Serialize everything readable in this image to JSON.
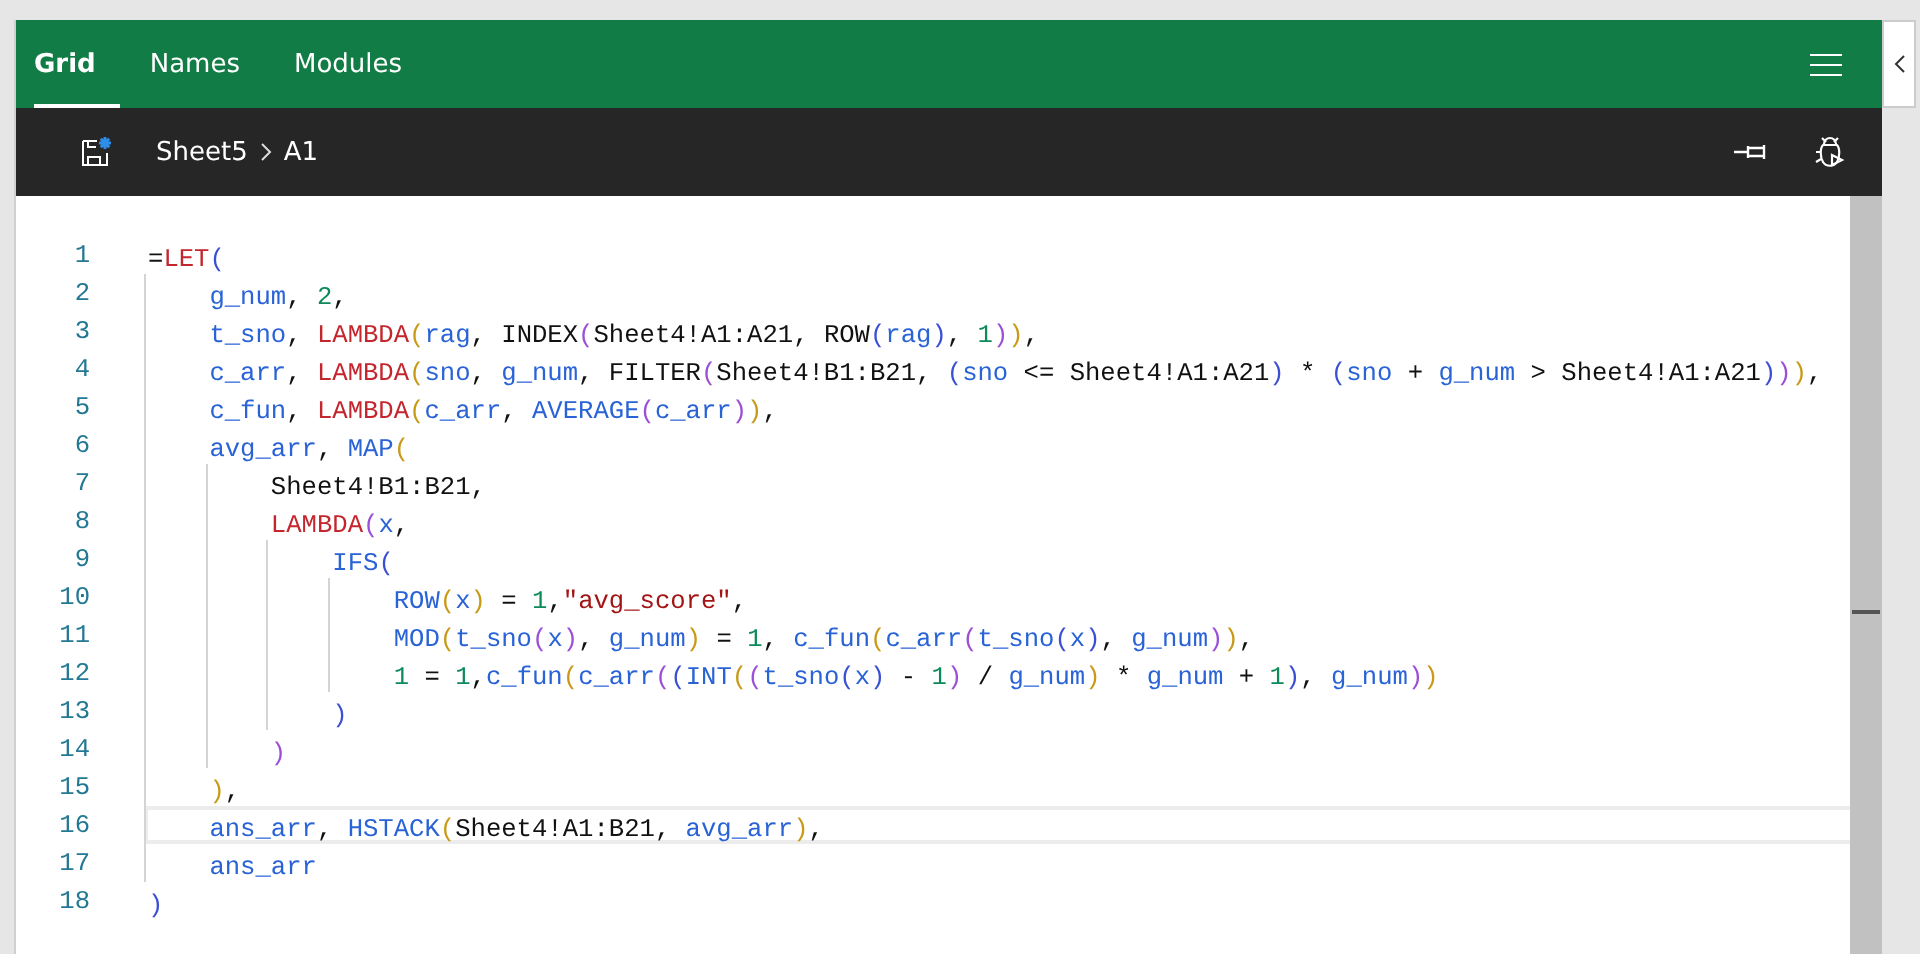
{
  "tabs": [
    {
      "label": "Grid",
      "selected": true
    },
    {
      "label": "Names",
      "selected": false
    },
    {
      "label": "Modules",
      "selected": false
    }
  ],
  "breadcrumb": [
    "Sheet5",
    "A1"
  ],
  "editor": {
    "lines": [
      {
        "number": "1",
        "current": false,
        "tokens": [
          {
            "kind": "op",
            "text": "="
          },
          {
            "kind": "kw",
            "text": "LET"
          },
          {
            "kind": "op",
            "text": "("
          }
        ]
      },
      {
        "number": "2",
        "current": false,
        "tokens": [
          {
            "kind": "id",
            "text": "g_num"
          },
          {
            "kind": "op",
            "text": ", "
          },
          {
            "kind": "num",
            "text": "2"
          },
          {
            "kind": "op",
            "text": ","
          }
        ]
      },
      {
        "number": "3",
        "current": false,
        "tokens": [
          {
            "kind": "id",
            "text": "t_sno"
          },
          {
            "kind": "op",
            "text": ", "
          },
          {
            "kind": "kw",
            "text": "LAMBDA"
          },
          {
            "kind": "op",
            "text": "("
          },
          {
            "kind": "id",
            "text": "rag"
          },
          {
            "kind": "op",
            "text": ", "
          },
          {
            "kind": "ref",
            "text": "INDEX"
          },
          {
            "kind": "op",
            "text": "("
          },
          {
            "kind": "ref",
            "text": "Sheet4!A1:A21"
          },
          {
            "kind": "op",
            "text": ", "
          },
          {
            "kind": "ref",
            "text": "ROW"
          },
          {
            "kind": "op",
            "text": "("
          },
          {
            "kind": "id",
            "text": "rag"
          },
          {
            "kind": "op",
            "text": "), "
          },
          {
            "kind": "num",
            "text": "1"
          },
          {
            "kind": "op",
            "text": ")),"
          }
        ]
      },
      {
        "number": "4",
        "current": false,
        "tokens": [
          {
            "kind": "id",
            "text": "c_arr"
          },
          {
            "kind": "op",
            "text": ", "
          },
          {
            "kind": "kw",
            "text": "LAMBDA"
          },
          {
            "kind": "op",
            "text": "("
          },
          {
            "kind": "id",
            "text": "sno"
          },
          {
            "kind": "op",
            "text": ", "
          },
          {
            "kind": "id",
            "text": "g_num"
          },
          {
            "kind": "op",
            "text": ", "
          },
          {
            "kind": "ref",
            "text": "FILTER"
          },
          {
            "kind": "op",
            "text": "("
          },
          {
            "kind": "ref",
            "text": "Sheet4!B1:B21"
          },
          {
            "kind": "op",
            "text": ", ("
          },
          {
            "kind": "id",
            "text": "sno"
          },
          {
            "kind": "op",
            "text": " <= "
          },
          {
            "kind": "ref",
            "text": "Sheet4!A1:A21"
          },
          {
            "kind": "op",
            "text": ") * ("
          },
          {
            "kind": "id",
            "text": "sno"
          },
          {
            "kind": "op",
            "text": " + "
          },
          {
            "kind": "id",
            "text": "g_num"
          },
          {
            "kind": "op",
            "text": " > "
          },
          {
            "kind": "ref",
            "text": "Sheet4!A1:A21"
          },
          {
            "kind": "op",
            "text": "))),"
          }
        ]
      },
      {
        "number": "5",
        "current": false,
        "tokens": [
          {
            "kind": "id",
            "text": "c_fun"
          },
          {
            "kind": "op",
            "text": ", "
          },
          {
            "kind": "kw",
            "text": "LAMBDA"
          },
          {
            "kind": "op",
            "text": "("
          },
          {
            "kind": "id",
            "text": "c_arr"
          },
          {
            "kind": "op",
            "text": ", "
          },
          {
            "kind": "fn",
            "text": "AVERAGE"
          },
          {
            "kind": "op",
            "text": "("
          },
          {
            "kind": "id",
            "text": "c_arr"
          },
          {
            "kind": "op",
            "text": ")),"
          }
        ]
      },
      {
        "number": "6",
        "current": false,
        "tokens": [
          {
            "kind": "id",
            "text": "avg_arr"
          },
          {
            "kind": "op",
            "text": ", "
          },
          {
            "kind": "fn",
            "text": "MAP"
          },
          {
            "kind": "op",
            "text": "("
          }
        ]
      },
      {
        "number": "7",
        "current": false,
        "tokens": [
          {
            "kind": "ref",
            "text": "Sheet4!B1:B21"
          },
          {
            "kind": "op",
            "text": ","
          }
        ]
      },
      {
        "number": "8",
        "current": false,
        "tokens": [
          {
            "kind": "kw",
            "text": "LAMBDA"
          },
          {
            "kind": "op",
            "text": "("
          },
          {
            "kind": "id",
            "text": "x"
          },
          {
            "kind": "op",
            "text": ","
          }
        ]
      },
      {
        "number": "9",
        "current": false,
        "tokens": [
          {
            "kind": "fn",
            "text": "IFS"
          },
          {
            "kind": "op",
            "text": "("
          }
        ]
      },
      {
        "number": "10",
        "current": false,
        "tokens": [
          {
            "kind": "fn",
            "text": "ROW"
          },
          {
            "kind": "op",
            "text": "("
          },
          {
            "kind": "id",
            "text": "x"
          },
          {
            "kind": "op",
            "text": ") = "
          },
          {
            "kind": "num",
            "text": "1"
          },
          {
            "kind": "op",
            "text": ","
          },
          {
            "kind": "str",
            "text": "\"avg_score\""
          },
          {
            "kind": "op",
            "text": ","
          }
        ]
      },
      {
        "number": "11",
        "current": false,
        "tokens": [
          {
            "kind": "fn",
            "text": "MOD"
          },
          {
            "kind": "op",
            "text": "("
          },
          {
            "kind": "id",
            "text": "t_sno"
          },
          {
            "kind": "op",
            "text": "("
          },
          {
            "kind": "id",
            "text": "x"
          },
          {
            "kind": "op",
            "text": "), "
          },
          {
            "kind": "id",
            "text": "g_num"
          },
          {
            "kind": "op",
            "text": ") = "
          },
          {
            "kind": "num",
            "text": "1"
          },
          {
            "kind": "op",
            "text": ", "
          },
          {
            "kind": "id",
            "text": "c_fun"
          },
          {
            "kind": "op",
            "text": "("
          },
          {
            "kind": "id",
            "text": "c_arr"
          },
          {
            "kind": "op",
            "text": "("
          },
          {
            "kind": "id",
            "text": "t_sno"
          },
          {
            "kind": "op",
            "text": "("
          },
          {
            "kind": "id",
            "text": "x"
          },
          {
            "kind": "op",
            "text": "), "
          },
          {
            "kind": "id",
            "text": "g_num"
          },
          {
            "kind": "op",
            "text": ")),"
          }
        ]
      },
      {
        "number": "12",
        "current": false,
        "tokens": [
          {
            "kind": "num",
            "text": "1"
          },
          {
            "kind": "op",
            "text": " = "
          },
          {
            "kind": "num",
            "text": "1"
          },
          {
            "kind": "op",
            "text": ","
          },
          {
            "kind": "id",
            "text": "c_fun"
          },
          {
            "kind": "op",
            "text": "("
          },
          {
            "kind": "id",
            "text": "c_arr"
          },
          {
            "kind": "op",
            "text": "(("
          },
          {
            "kind": "fn",
            "text": "INT"
          },
          {
            "kind": "op",
            "text": "(("
          },
          {
            "kind": "id",
            "text": "t_sno"
          },
          {
            "kind": "op",
            "text": "("
          },
          {
            "kind": "id",
            "text": "x"
          },
          {
            "kind": "op",
            "text": ") - "
          },
          {
            "kind": "num",
            "text": "1"
          },
          {
            "kind": "op",
            "text": ") / "
          },
          {
            "kind": "id",
            "text": "g_num"
          },
          {
            "kind": "op",
            "text": ") * "
          },
          {
            "kind": "id",
            "text": "g_num"
          },
          {
            "kind": "op",
            "text": " + "
          },
          {
            "kind": "num",
            "text": "1"
          },
          {
            "kind": "op",
            "text": "), "
          },
          {
            "kind": "id",
            "text": "g_num"
          },
          {
            "kind": "op",
            "text": "))"
          }
        ]
      },
      {
        "number": "13",
        "current": false,
        "tokens": [
          {
            "kind": "op",
            "text": ")"
          }
        ]
      },
      {
        "number": "14",
        "current": false,
        "tokens": [
          {
            "kind": "op",
            "text": ")"
          }
        ]
      },
      {
        "number": "15",
        "current": false,
        "tokens": [
          {
            "kind": "op",
            "text": "),"
          }
        ]
      },
      {
        "number": "16",
        "current": true,
        "tokens": [
          {
            "kind": "id",
            "text": "ans_arr"
          },
          {
            "kind": "op",
            "text": ", "
          },
          {
            "kind": "fn",
            "text": "HSTACK"
          },
          {
            "kind": "op",
            "text": "("
          },
          {
            "kind": "ref",
            "text": "Sheet4!A1:B21"
          },
          {
            "kind": "op",
            "text": ", "
          },
          {
            "kind": "id",
            "text": "avg_arr"
          },
          {
            "kind": "op",
            "text": "),"
          }
        ]
      },
      {
        "number": "17",
        "current": false,
        "tokens": [
          {
            "kind": "id",
            "text": "ans_arr"
          }
        ]
      },
      {
        "number": "18",
        "current": false,
        "tokens": [
          {
            "kind": "op",
            "text": ")"
          }
        ]
      }
    ]
  }
}
